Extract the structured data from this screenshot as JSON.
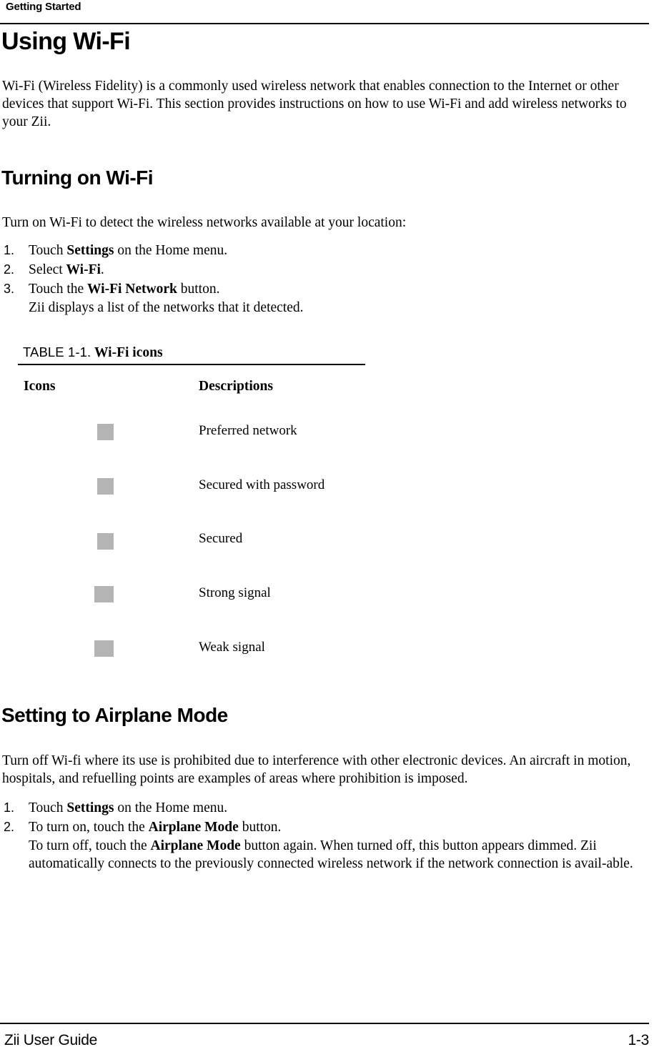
{
  "header": {
    "running_head": "Getting Started"
  },
  "sections": {
    "using_wifi": {
      "heading": "Using Wi-Fi",
      "intro": "Wi-Fi (Wireless Fidelity) is a commonly used wireless network that enables connection to the Internet or other devices that support Wi-Fi. This section provides instructions on how to use Wi-Fi and add wireless networks to your Zii."
    },
    "turning_on_wifi": {
      "heading": "Turning on Wi-Fi",
      "intro": "Turn on Wi-Fi to detect the wireless networks available at your location:",
      "steps": [
        {
          "marker": "1.",
          "pre": "Touch ",
          "bold": "Settings",
          "post": " on the Home menu."
        },
        {
          "marker": "2.",
          "pre": "Select ",
          "bold": "Wi-Fi",
          "post": "."
        },
        {
          "marker": "3.",
          "pre": "Touch the ",
          "bold": "Wi-Fi Network",
          "post": " button."
        }
      ],
      "step_continuation": "Zii displays a list of the networks that it detected."
    },
    "airplane_mode": {
      "heading": "Setting to Airplane Mode",
      "intro": "Turn off Wi-fi where its use is prohibited due to interference with other electronic devices. An aircraft in motion, hospitals, and refuelling points are examples of areas where prohibition is imposed.",
      "steps": [
        {
          "marker": "1.",
          "pre": "Touch ",
          "bold": "Settings",
          "post": " on the Home menu."
        },
        {
          "marker": "2.",
          "pre": "To turn on, touch the ",
          "bold": "Airplane Mode",
          "post": " button."
        }
      ],
      "step_continuation_pre": "To turn off, touch the ",
      "step_continuation_bold": "Airplane Mode",
      "step_continuation_post": " button again. When turned off, this button appears dimmed. Zii automatically connects to the previously connected wireless network if the network connection is avail-able."
    }
  },
  "table": {
    "caption_label": "TABLE 1-1.",
    "caption_title": "Wi-Fi icons",
    "columns": {
      "icons": "Icons",
      "descriptions": "Descriptions"
    },
    "rows": [
      {
        "icon_name": "preferred-network-icon",
        "description": "Preferred network"
      },
      {
        "icon_name": "secured-with-password-icon",
        "description": "Secured with password"
      },
      {
        "icon_name": "secured-icon",
        "description": "Secured"
      },
      {
        "icon_name": "strong-signal-icon",
        "description": "Strong signal"
      },
      {
        "icon_name": "weak-signal-icon",
        "description": "Weak signal"
      }
    ],
    "icon_placeholder_color": "#b4b4b4"
  },
  "footer": {
    "document_title": "Zii User Guide",
    "page_number": "1-3"
  }
}
